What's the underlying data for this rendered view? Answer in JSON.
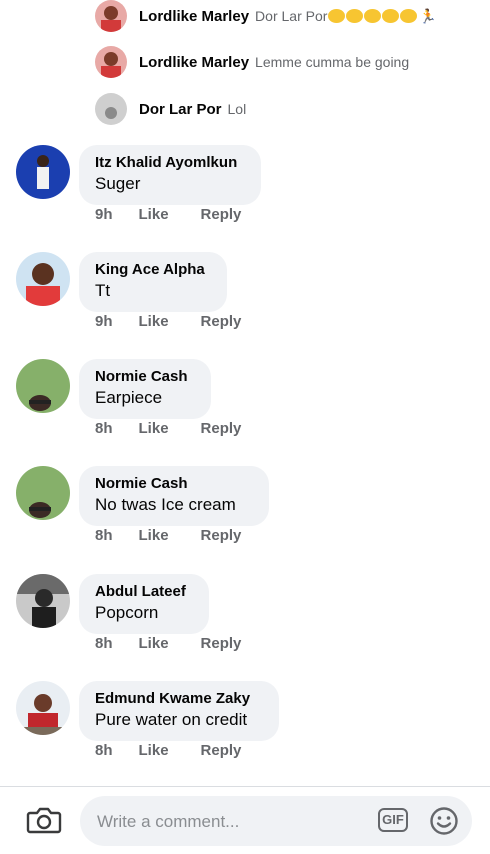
{
  "replies": [
    {
      "name": "Lordlike Marley",
      "text": "Dor Lar Por",
      "has_emojis": true
    },
    {
      "name": "Lordlike Marley",
      "text": "Lemme cumma be going",
      "has_emojis": false
    },
    {
      "name": "Dor Lar Por",
      "text": "Lol",
      "has_emojis": false
    }
  ],
  "comments": [
    {
      "author": "Itz Khalid Ayomlkun",
      "text": "Suger",
      "time": "9h",
      "like": "Like",
      "reply": "Reply"
    },
    {
      "author": "King Ace Alpha",
      "text": "Tt",
      "time": "9h",
      "like": "Like",
      "reply": "Reply"
    },
    {
      "author": "Normie Cash",
      "text": "Earpiece",
      "time": "8h",
      "like": "Like",
      "reply": "Reply"
    },
    {
      "author": "Normie Cash",
      "text": "No twas Ice cream",
      "time": "8h",
      "like": "Like",
      "reply": "Reply"
    },
    {
      "author": "Abdul Lateef",
      "text": "Popcorn",
      "time": "8h",
      "like": "Like",
      "reply": "Reply"
    },
    {
      "author": "Edmund Kwame Zaky",
      "text": "Pure water on credit",
      "time": "8h",
      "like": "Like",
      "reply": "Reply"
    }
  ],
  "composer": {
    "placeholder": "Write a comment...",
    "gif_label": "GIF",
    "camera_icon": "camera-icon",
    "emoji_icon": "smiley-icon"
  }
}
